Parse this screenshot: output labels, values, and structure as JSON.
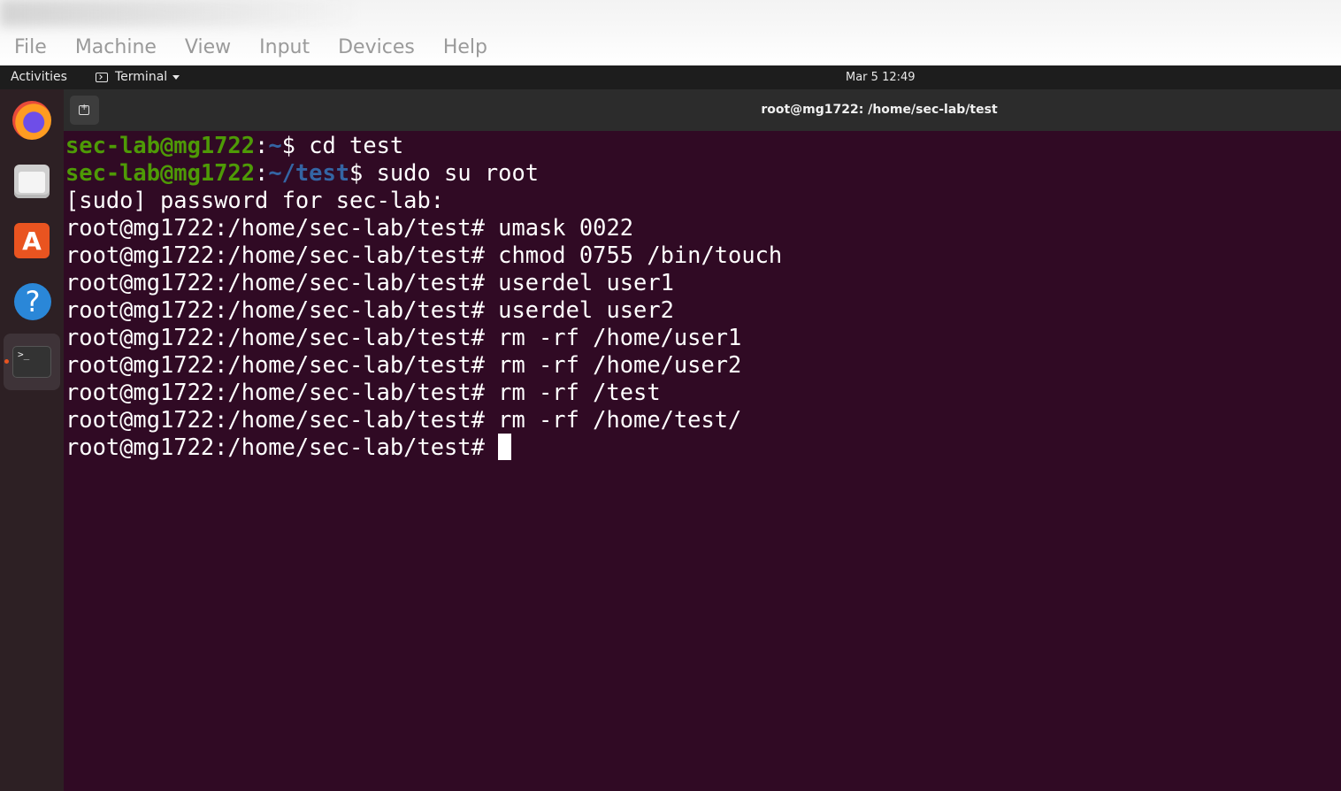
{
  "host_menu": [
    "File",
    "Machine",
    "View",
    "Input",
    "Devices",
    "Help"
  ],
  "topbar": {
    "activities": "Activities",
    "app_name": "Terminal",
    "clock": "Mar 5  12:49"
  },
  "dock": {
    "items": [
      "firefox-icon",
      "files-icon",
      "software-icon",
      "help-icon",
      "terminal-icon"
    ],
    "help_glyph": "?",
    "store_glyph": "A",
    "terminal_glyph": ">_"
  },
  "terminal": {
    "title": "root@mg1722: /home/sec-lab/test",
    "lines": [
      {
        "user": "sec-lab@mg1722",
        "sep": ":",
        "path": "~",
        "prompt": "$ ",
        "cmd": "cd test"
      },
      {
        "user": "sec-lab@mg1722",
        "sep": ":",
        "path": "~/test",
        "prompt": "$ ",
        "cmd": "sudo su root"
      },
      {
        "text": "[sudo] password for sec-lab:"
      },
      {
        "text": "root@mg1722:/home/sec-lab/test# umask 0022"
      },
      {
        "text": "root@mg1722:/home/sec-lab/test# chmod 0755 /bin/touch"
      },
      {
        "text": "root@mg1722:/home/sec-lab/test# userdel user1"
      },
      {
        "text": "root@mg1722:/home/sec-lab/test# userdel user2"
      },
      {
        "text": "root@mg1722:/home/sec-lab/test# rm -rf /home/user1"
      },
      {
        "text": "root@mg1722:/home/sec-lab/test# rm -rf /home/user2"
      },
      {
        "text": "root@mg1722:/home/sec-lab/test# rm -rf /test"
      },
      {
        "text": "root@mg1722:/home/sec-lab/test# rm -rf /home/test/"
      },
      {
        "text": "root@mg1722:/home/sec-lab/test# "
      }
    ]
  },
  "colors": {
    "terminal_bg": "#300a24",
    "user_green": "#4e9a06",
    "path_blue": "#3465a4",
    "accent_orange": "#e95420"
  }
}
